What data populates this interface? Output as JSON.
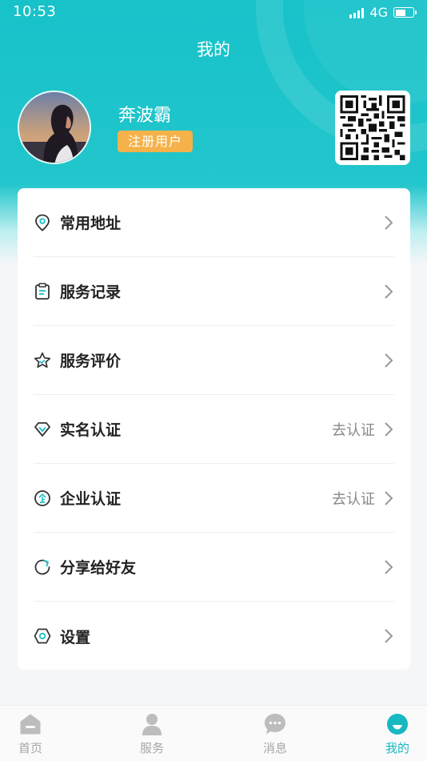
{
  "status": {
    "time": "10:53",
    "network": "4G",
    "battery_level": 0.6
  },
  "page": {
    "title": "我的"
  },
  "profile": {
    "name": "奔波霸",
    "badge": "注册用户"
  },
  "menu": [
    {
      "label": "常用地址",
      "icon": "location-pin-icon",
      "extra": ""
    },
    {
      "label": "服务记录",
      "icon": "clipboard-icon",
      "extra": ""
    },
    {
      "label": "服务评价",
      "icon": "star-icon",
      "extra": ""
    },
    {
      "label": "实名认证",
      "icon": "diamond-icon",
      "extra": "去认证"
    },
    {
      "label": "企业认证",
      "icon": "enterprise-icon",
      "extra": "去认证"
    },
    {
      "label": "分享给好友",
      "icon": "share-icon",
      "extra": ""
    },
    {
      "label": "设置",
      "icon": "settings-icon",
      "extra": ""
    }
  ],
  "tabs": [
    {
      "label": "首页",
      "icon": "home-icon",
      "active": false
    },
    {
      "label": "服务",
      "icon": "person-icon",
      "active": false
    },
    {
      "label": "消息",
      "icon": "chat-icon",
      "active": false
    },
    {
      "label": "我的",
      "icon": "profile-icon",
      "active": true
    }
  ],
  "colors": {
    "accent": "#17c2c9",
    "badge": "#f5b24a",
    "active_tab": "#17b8c1"
  }
}
